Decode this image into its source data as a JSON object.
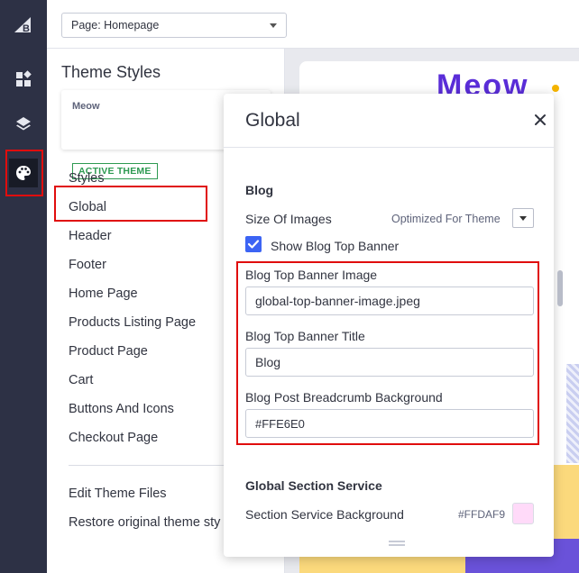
{
  "rail": {
    "logo": "bigcommerce-logo",
    "items": [
      {
        "name": "widgets-icon"
      },
      {
        "name": "layers-icon"
      },
      {
        "name": "palette-icon",
        "active": true
      }
    ]
  },
  "topbar": {
    "page_select": "Page: Homepage"
  },
  "sidebar": {
    "title": "Theme Styles",
    "theme_card": {
      "name": "Meow",
      "badge": "ACTIVE THEME"
    },
    "menu": [
      {
        "label": "Styles"
      },
      {
        "label": "Global",
        "selected": true
      },
      {
        "label": "Header"
      },
      {
        "label": "Footer"
      },
      {
        "label": "Home Page"
      },
      {
        "label": "Products Listing Page"
      },
      {
        "label": "Product Page"
      },
      {
        "label": "Cart"
      },
      {
        "label": "Buttons And Icons"
      },
      {
        "label": "Checkout Page"
      }
    ],
    "menu2": [
      {
        "label": "Edit Theme Files"
      },
      {
        "label": "Restore original theme sty"
      }
    ]
  },
  "preview": {
    "brand": "Meow"
  },
  "modal": {
    "title": "Global",
    "blog": {
      "heading": "Blog",
      "size_of_images_label": "Size Of Images",
      "size_of_images_value": "Optimized For Theme",
      "show_banner_label": "Show Blog Top Banner",
      "show_banner_checked": true,
      "banner_image_label": "Blog Top Banner Image",
      "banner_image_value": "global-top-banner-image.jpeg",
      "banner_title_label": "Blog Top Banner Title",
      "banner_title_value": "Blog",
      "breadcrumb_bg_label": "Blog Post Breadcrumb Background",
      "breadcrumb_bg_value": "#FFE6E0"
    },
    "section_service": {
      "heading": "Global Section Service",
      "bg_label": "Section Service Background",
      "bg_value": "#FFDAF9",
      "bg_color": "#FFDAF9"
    }
  },
  "colors": {
    "rail_bg": "#2D3145",
    "highlight_red": "#E00D0D",
    "checkbox_blue": "#3C64F4",
    "badge_green": "#2E9A52"
  }
}
